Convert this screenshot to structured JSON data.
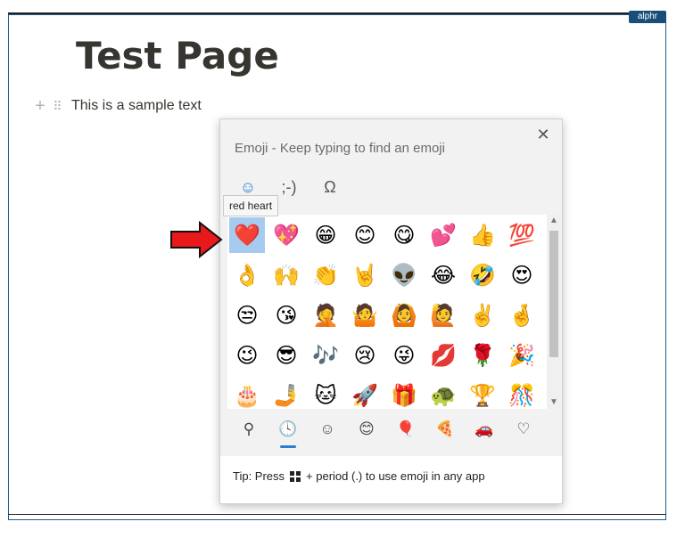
{
  "watermark": "alphr",
  "page": {
    "title": "Test Page",
    "block_text": "This is a sample text",
    "add_glyph": "+",
    "drag_glyph": "⠿"
  },
  "emoji_panel": {
    "header": "Emoji - Keep typing to find an emoji",
    "close_glyph": "✕",
    "mode_tabs": [
      "☺",
      ";-)",
      "Ω"
    ],
    "tooltip": "red heart",
    "rows": [
      [
        "❤️",
        "💖",
        "😁",
        "😊",
        "😋",
        "💕",
        "👍",
        "💯"
      ],
      [
        "👌",
        "🙌",
        "👏",
        "🤘",
        "👽",
        "😂",
        "🤣",
        "😍"
      ],
      [
        "😒",
        "😘",
        "🤦",
        "🤷",
        "🙆",
        "🙋",
        "✌️",
        "🤞"
      ],
      [
        "😉",
        "😎",
        "🎶",
        "😢",
        "😜",
        "💋",
        "🌹",
        "🎉"
      ],
      [
        "🎂",
        "🤳",
        "🐱",
        "🚀",
        "🎁",
        "🐢",
        "🏆",
        "🎊"
      ]
    ],
    "categories": [
      "⚲",
      "🕓",
      "☺",
      "😊",
      "🎈",
      "🍕",
      "🚗",
      "♡"
    ],
    "tip_prefix": "Tip: Press",
    "tip_suffix": "+ period (.) to use emoji in any app"
  },
  "colors": {
    "accent": "#2b7cd3",
    "selection": "#a6cbef",
    "arrow": "#e8191a"
  }
}
